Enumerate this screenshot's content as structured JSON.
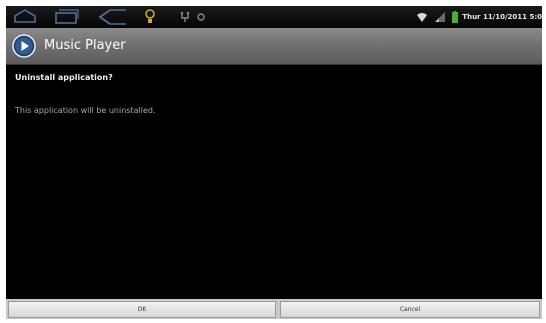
{
  "status_bar": {
    "time": "Thur 11/10/2011 5:0",
    "nav_icons": [
      "home-icon",
      "back-icon",
      "recent-apps-icon",
      "bulb-icon",
      "usb-icon",
      "circle-icon"
    ],
    "indicator_icons": [
      "wifi-icon",
      "signal-icon",
      "battery-icon"
    ]
  },
  "title_bar": {
    "app_title": "Music Player",
    "icon": "music-player-icon"
  },
  "dialog": {
    "title": "Uninstall application?",
    "message": "This application will be uninstalled."
  },
  "buttons": {
    "ok_label": "OK",
    "cancel_label": "Cancel"
  },
  "colors": {
    "background": "#000000",
    "title_bar": "#6f6f6f",
    "button_bar": "#c9c9c9",
    "battery": "#4caf2f"
  }
}
